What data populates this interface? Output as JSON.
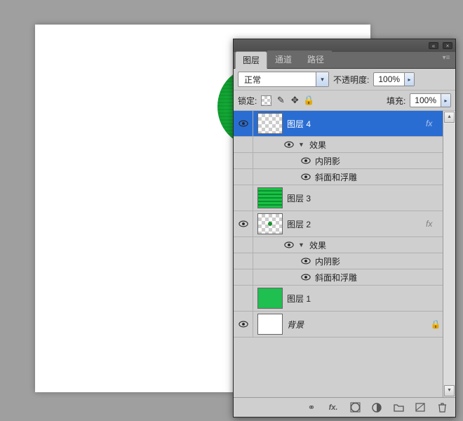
{
  "tabs": {
    "layers": "图层",
    "channels": "通道",
    "paths": "路径"
  },
  "controls": {
    "blend_mode": "正常",
    "opacity_label": "不透明度:",
    "opacity_value": "100%",
    "lock_label": "锁定:",
    "fill_label": "填充:",
    "fill_value": "100%"
  },
  "layers": [
    {
      "name": "图层 4",
      "fx_badge": "fx",
      "effects_label": "效果",
      "effects": [
        "内阴影",
        "斜面和浮雕"
      ]
    },
    {
      "name": "图层 3"
    },
    {
      "name": "图层 2",
      "fx_badge": "fx",
      "effects_label": "效果",
      "effects": [
        "内阴影",
        "斜面和浮雕"
      ]
    },
    {
      "name": "图层 1"
    },
    {
      "name": "背景"
    }
  ],
  "icons": {
    "link": "⚭",
    "fx": "fx.",
    "mask": "◐",
    "adjust": "◑",
    "group": "▭",
    "new": "▤",
    "trash": "🗑"
  }
}
